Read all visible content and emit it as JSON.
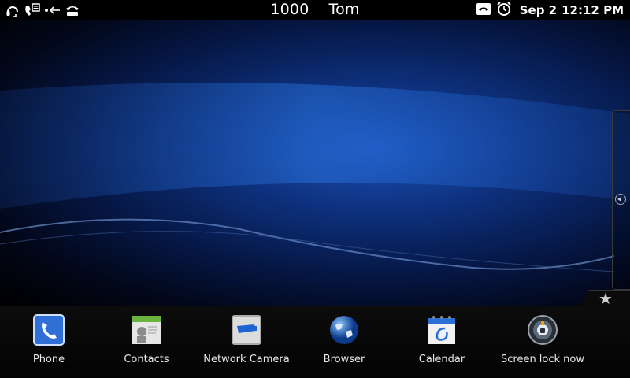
{
  "status_bar": {
    "extension": "1000",
    "user": "Tom",
    "date": "Sep 2",
    "time": "12:12 PM",
    "left_icons": [
      "headset-icon",
      "voicemail-icon",
      "call-transfer-icon",
      "handset-icon"
    ],
    "right_icons": [
      "call-hold-icon",
      "alarm-clock-icon"
    ]
  },
  "dock": {
    "items": [
      {
        "label": "Phone",
        "icon": "phone-icon"
      },
      {
        "label": "Contacts",
        "icon": "contacts-icon"
      },
      {
        "label": "Network Camera",
        "icon": "network-camera-icon"
      },
      {
        "label": "Browser",
        "icon": "browser-globe-icon"
      },
      {
        "label": "Calendar",
        "icon": "calendar-icon"
      },
      {
        "label": "Screen lock now",
        "icon": "screen-lock-icon"
      }
    ],
    "favorites_icon": "star-icon"
  },
  "side_panel": {
    "icon": "expand-left-arrow-icon"
  },
  "colors": {
    "accent_blue": "#1a4fb5",
    "dock_bg": "#0a0a0a",
    "text": "#ffffff"
  }
}
